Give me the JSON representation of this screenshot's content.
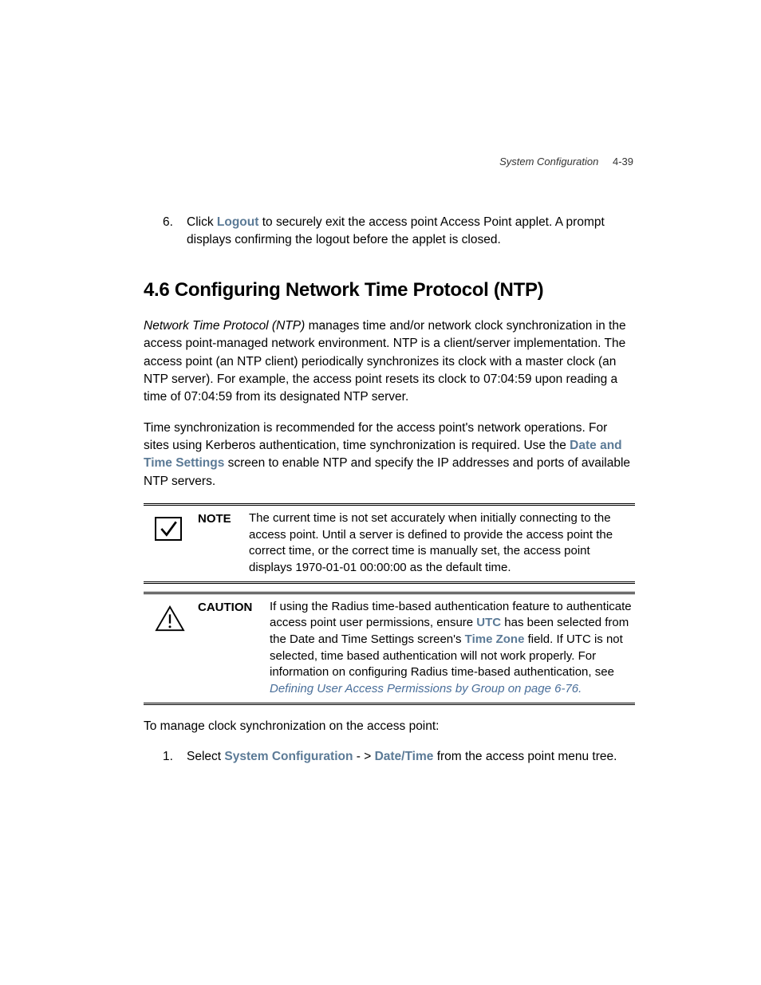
{
  "header": {
    "section": "System Configuration",
    "page": "4-39"
  },
  "item6": {
    "num": "6.",
    "t1": "Click ",
    "logout": "Logout",
    "t2": " to securely exit the access point Access Point applet. A prompt displays confirming the logout before the applet is closed."
  },
  "heading": "4.6  Configuring Network Time Protocol (NTP)",
  "para1": {
    "lead": "Network Time Protocol (NTP)",
    "rest": " manages time and/or network clock synchronization in the access point-managed network environment. NTP is a client/server implementation. The access point (an NTP client) periodically synchronizes its clock with a master clock (an NTP server). For example, the access point resets its clock to 07:04:59 upon reading a time of 07:04:59 from its designated NTP server."
  },
  "para2": {
    "t1": "Time synchronization is recommended for the access point's network operations. For sites using Kerberos authentication, time synchronization is required. Use the ",
    "link": "Date and Time Settings",
    "t2": " screen to enable NTP and specify the IP addresses and ports of available NTP servers."
  },
  "note": {
    "label": "NOTE",
    "text": "The current time is not set accurately when initially connecting to the access point. Until a server is defined to provide the access point the correct time, or the correct time is manually set, the access point displays 1970-01-01 00:00:00 as the default time."
  },
  "caution": {
    "label": "CAUTION",
    "t1": "If using the Radius time-based authentication feature to authenticate access point user permissions, ensure ",
    "utc": "UTC",
    "t2": " has been selected from the Date and Time Settings screen's ",
    "tz": "Time Zone",
    "t3": " field. If UTC is not selected, time based authentication will not work properly. For information on configuring Radius time-based authentication, see ",
    "xref": "Defining User Access Permissions by Group on page 6-76",
    "period": "."
  },
  "para3": "To manage clock synchronization on the access point:",
  "step1": {
    "num": "1.",
    "t1": "Select ",
    "sc": "System Configuration",
    "arrow": " - > ",
    "dt": "Date/Time",
    "t2": " from the access point menu tree."
  }
}
